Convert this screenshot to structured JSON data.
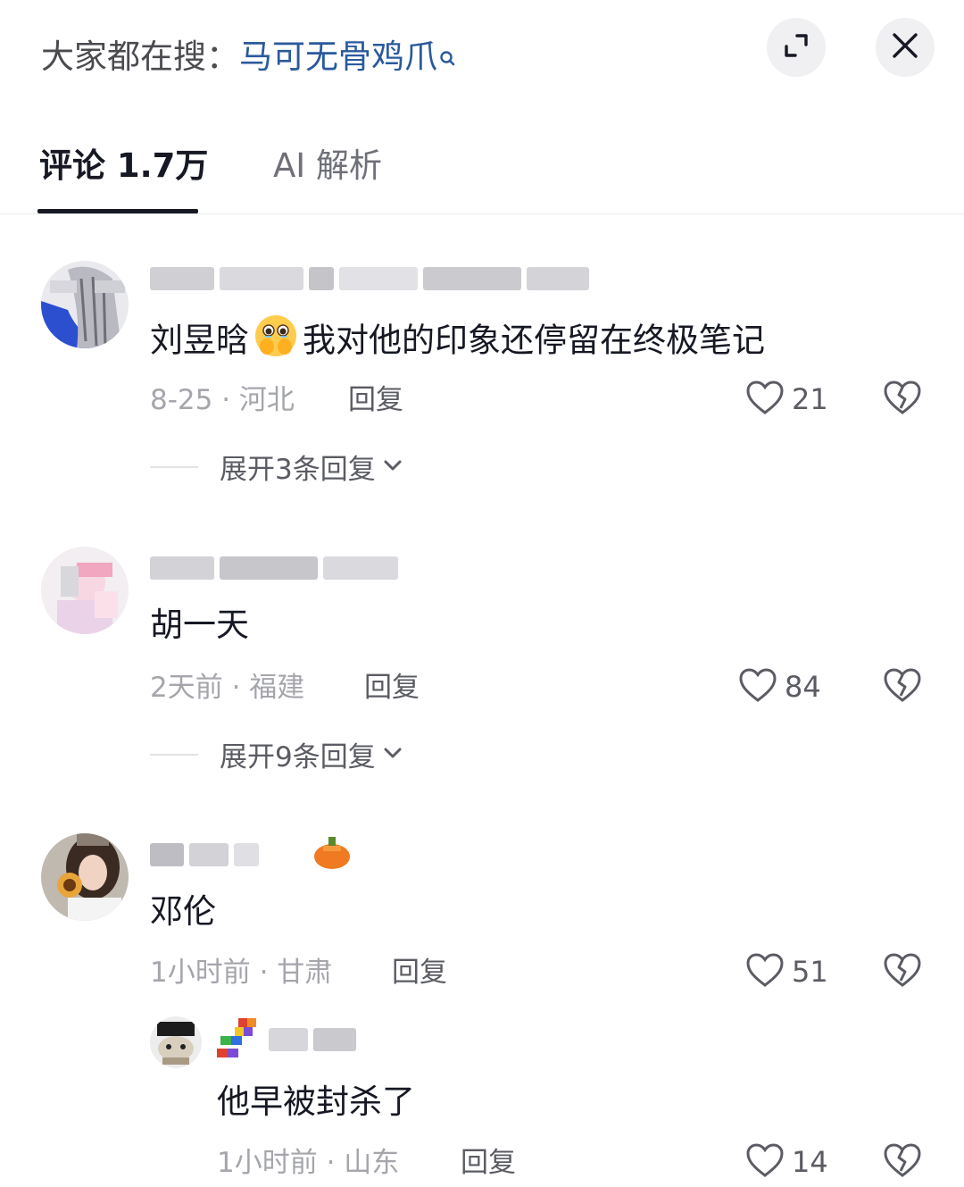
{
  "header": {
    "search_prefix": "大家都在搜：",
    "search_term": "马可无骨鸡爪"
  },
  "tabs": {
    "comments_label": "评论 1.7万",
    "ai_label": "AI 解析"
  },
  "colors": {
    "link_blue": "#2a5a9c",
    "primary_text": "#161823",
    "secondary_text": "#a5a6ac"
  },
  "comments": [
    {
      "text_before": "刘昱晗",
      "emoji": "holding-back-tears-emoji",
      "text_after": "我对他的印象还停留在终极笔记",
      "meta": "8-25 · 河北",
      "reply_label": "回复",
      "likes": "21",
      "expand_label": "展开3条回复"
    },
    {
      "text": "胡一天",
      "meta": "2天前 · 福建",
      "reply_label": "回复",
      "likes": "84",
      "expand_label": "展开9条回复"
    },
    {
      "text": "邓伦",
      "meta": "1小时前 · 甘肃",
      "reply_label": "回复",
      "likes": "51",
      "badge_icon": "orange-fruit-icon"
    }
  ],
  "replies": [
    {
      "text": "他早被封杀了",
      "meta": "1小时前 · 山东",
      "reply_label": "回复",
      "likes": "14"
    }
  ]
}
